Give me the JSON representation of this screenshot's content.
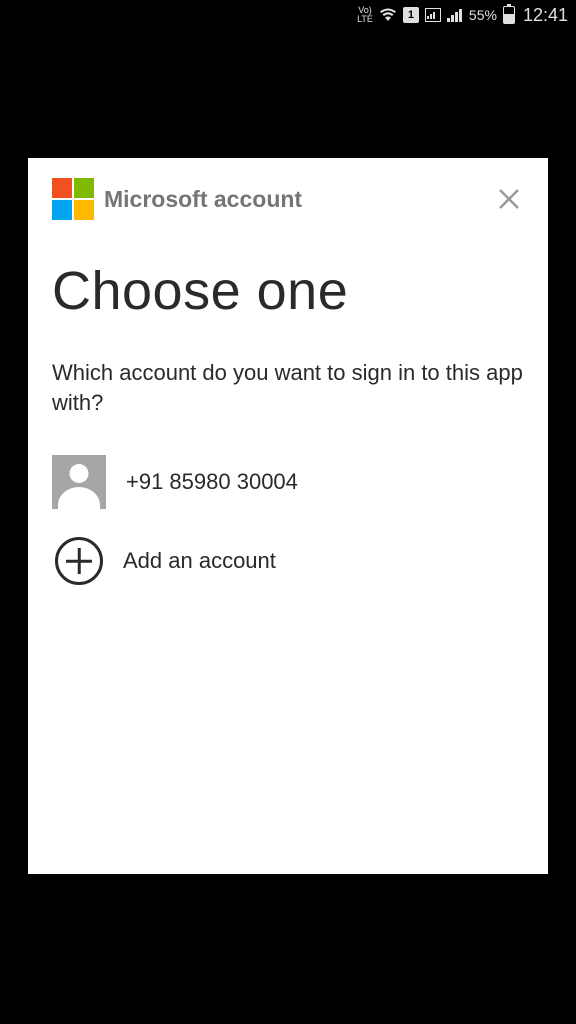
{
  "status_bar": {
    "lte_top": "Vo)",
    "lte_bottom": "LTE",
    "sim_number": "1",
    "battery_percent": "55%",
    "time": "12:41"
  },
  "dialog": {
    "title": "Microsoft account",
    "heading": "Choose one",
    "subtext": "Which account do you want to sign in to this app with?",
    "accounts": [
      {
        "label": "+91 85980 30004"
      }
    ],
    "add_account_label": "Add an account"
  }
}
